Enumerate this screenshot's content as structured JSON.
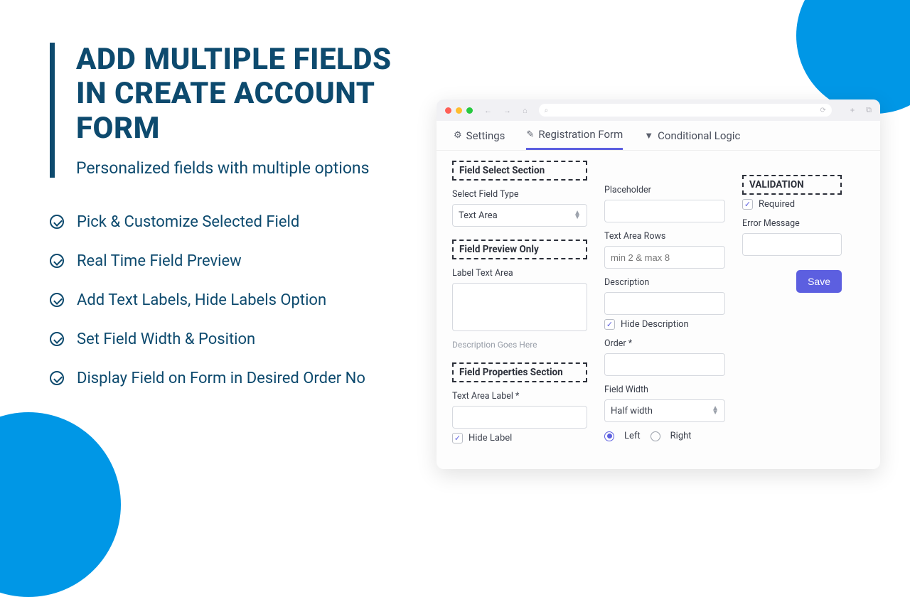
{
  "promo": {
    "title": "ADD MULTIPLE FIELDS IN CREATE ACCOUNT FORM",
    "subtitle": "Personalized fields with multiple options",
    "bullets": [
      "Pick & Customize Selected Field",
      "Real Time Field Preview",
      "Add Text Labels, Hide Labels Option",
      "Set Field Width & Position",
      "Display Field on Form in Desired Order No"
    ]
  },
  "app": {
    "tabs": {
      "settings": "Settings",
      "registration": "Registration Form",
      "conditional": "Conditional Logic"
    },
    "sections": {
      "fieldSelect": "Field Select Section",
      "fieldPreview": "Field Preview Only",
      "fieldProps": "Field Properties Section",
      "validation": "VALIDATION"
    },
    "labels": {
      "selectFieldType": "Select Field Type",
      "labelTextArea": "Label Text Area",
      "descriptionGoesHere": "Description Goes Here",
      "textAreaLabel": "Text Area Label",
      "hideLabel": "Hide Label",
      "placeholder": "Placeholder",
      "textAreaRows": "Text Area Rows",
      "description": "Description",
      "hideDescription": "Hide Description",
      "order": "Order",
      "fieldWidth": "Field Width",
      "left": "Left",
      "right": "Right",
      "required": "Required",
      "errorMessage": "Error Message",
      "save": "Save"
    },
    "values": {
      "selectFieldType": "Text Area",
      "textAreaRowsPlaceholder": "min 2 & max 8",
      "fieldWidth": "Half width",
      "hideLabelChecked": true,
      "hideDescriptionChecked": true,
      "requiredChecked": true,
      "positionSelected": "left"
    }
  },
  "colors": {
    "brand": "#0d4a6e",
    "accent": "#5c5fe0",
    "blob": "#0097e6"
  }
}
